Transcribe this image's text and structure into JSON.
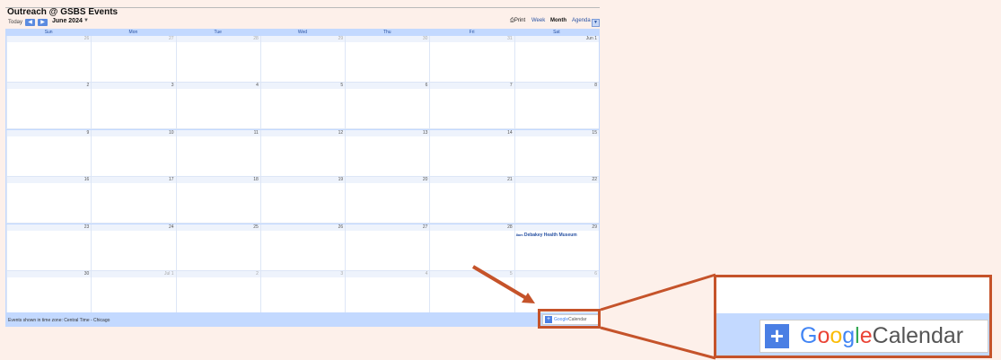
{
  "calendar": {
    "title": "Outreach @ GSBS Events",
    "today_label": "Today",
    "prev_icon": "chevron-left-icon",
    "next_icon": "chevron-right-icon",
    "date_range": "June 2024",
    "print_label": "Print",
    "views": [
      "Week",
      "Month",
      "Agenda"
    ],
    "selected_view": "Month",
    "days_of_week": [
      "Sun",
      "Mon",
      "Tue",
      "Wed",
      "Thu",
      "Fri",
      "Sat"
    ],
    "weeks": [
      [
        {
          "d": "26",
          "other": true
        },
        {
          "d": "27",
          "other": true
        },
        {
          "d": "28",
          "other": true
        },
        {
          "d": "29",
          "other": true
        },
        {
          "d": "30",
          "other": true
        },
        {
          "d": "31",
          "other": true
        },
        {
          "d": "Jun 1",
          "other": false
        }
      ],
      [
        {
          "d": "2"
        },
        {
          "d": "3"
        },
        {
          "d": "4"
        },
        {
          "d": "5"
        },
        {
          "d": "6"
        },
        {
          "d": "7"
        },
        {
          "d": "8"
        }
      ],
      [
        {
          "d": "9"
        },
        {
          "d": "10"
        },
        {
          "d": "11"
        },
        {
          "d": "12"
        },
        {
          "d": "13"
        },
        {
          "d": "14"
        },
        {
          "d": "15"
        }
      ],
      [
        {
          "d": "16"
        },
        {
          "d": "17"
        },
        {
          "d": "18"
        },
        {
          "d": "19"
        },
        {
          "d": "20"
        },
        {
          "d": "21"
        },
        {
          "d": "22"
        }
      ],
      [
        {
          "d": "23"
        },
        {
          "d": "24"
        },
        {
          "d": "25"
        },
        {
          "d": "26"
        },
        {
          "d": "27"
        },
        {
          "d": "28"
        },
        {
          "d": "29",
          "event_time": "8am",
          "event_title": "Debakey Health Museum"
        }
      ],
      [
        {
          "d": "30"
        },
        {
          "d": "Jul 1",
          "other": true
        },
        {
          "d": "2",
          "other": true
        },
        {
          "d": "3",
          "other": true
        },
        {
          "d": "4",
          "other": true
        },
        {
          "d": "5",
          "other": true
        },
        {
          "d": "6",
          "other": true
        }
      ]
    ],
    "timezone_note": "Events shown in time zone: Central Time - Chicago",
    "gcal_button": {
      "plus": "+",
      "google": "Google",
      "calendar": "Calendar"
    }
  },
  "colors": {
    "accent": "#c3d9ff",
    "highlight": "#c5532a",
    "link": "#2952a3"
  }
}
